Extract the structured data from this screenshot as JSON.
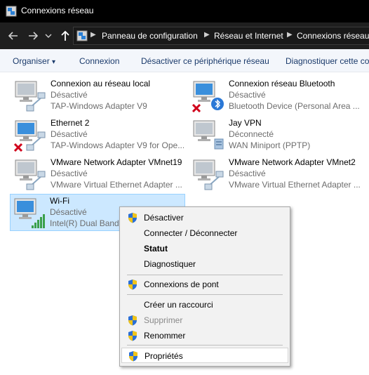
{
  "window": {
    "title": "Connexions réseau"
  },
  "breadcrumb": [
    {
      "label": "Panneau de configuration"
    },
    {
      "label": "Réseau et Internet"
    },
    {
      "label": "Connexions réseau"
    }
  ],
  "toolbar": {
    "organize": "Organiser",
    "organize_arrow": "▾",
    "connect": "Connexion",
    "disable": "Désactiver ce périphérique réseau",
    "diagnose": "Diagnostiquer cette co"
  },
  "adapters": [
    {
      "name": "Connexion au réseau local",
      "status": "Désactivé",
      "device": "TAP-Windows Adapter V9",
      "icon": "ethernet-icon",
      "badge": ""
    },
    {
      "name": "Connexion réseau Bluetooth",
      "status": "Désactivé",
      "device": "Bluetooth Device (Personal Area ...",
      "icon": "bluetooth-network-icon",
      "badge": "error-x-icon"
    },
    {
      "name": "Ethernet 2",
      "status": "Désactivé",
      "device": "TAP-Windows Adapter V9 for Ope...",
      "icon": "ethernet-icon",
      "badge": "error-x-icon"
    },
    {
      "name": "Jay VPN",
      "status": "Déconnecté",
      "device": "WAN Miniport (PPTP)",
      "icon": "vpn-icon",
      "badge": ""
    },
    {
      "name": "VMware Network Adapter VMnet19",
      "status": "Désactivé",
      "device": "VMware Virtual Ethernet Adapter ...",
      "icon": "ethernet-icon",
      "badge": ""
    },
    {
      "name": "VMware Network Adapter VMnet2",
      "status": "Désactivé",
      "device": "VMware Virtual Ethernet Adapter ...",
      "icon": "ethernet-icon",
      "badge": ""
    },
    {
      "name": "Wi-Fi",
      "status": "Désactivé",
      "device": "Intel(R) Dual Band",
      "icon": "wifi-icon",
      "badge": ""
    }
  ],
  "context_menu": {
    "items": [
      {
        "label": "Désactiver",
        "shield": true
      },
      {
        "label": "Connecter / Déconnecter",
        "shield": false
      },
      {
        "label": "Statut",
        "shield": false,
        "bold": true
      },
      {
        "label": "Diagnostiquer",
        "shield": false
      },
      {
        "label": "Connexions de pont",
        "shield": true
      },
      {
        "label": "Créer un raccourci",
        "shield": false
      },
      {
        "label": "Supprimer",
        "shield": true,
        "disabled": true
      },
      {
        "label": "Renommer",
        "shield": true
      },
      {
        "label": "Propriétés",
        "shield": true,
        "highlighted": true
      }
    ]
  },
  "colors": {
    "titlebar": "#000000",
    "navbar": "#1f1f1f",
    "selection": "#cce8ff",
    "link_text": "#1a3a6b"
  }
}
